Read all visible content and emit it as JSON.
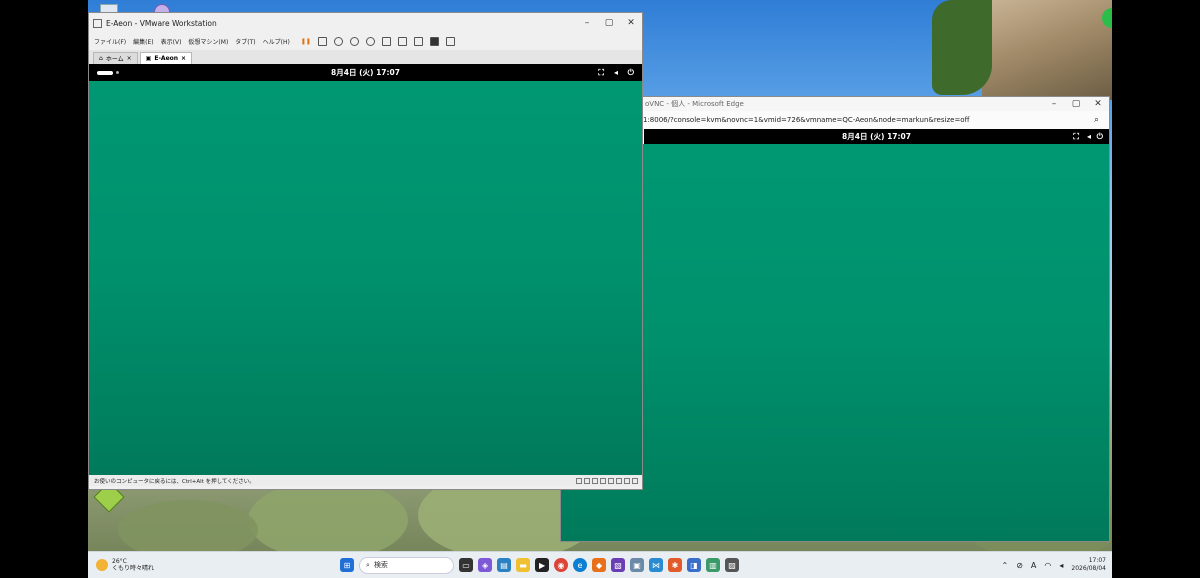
{
  "vmware": {
    "title": "E-Aeon - VMware Workstation",
    "menu": [
      "ファイル(F)",
      "編集(E)",
      "表示(V)",
      "仮想マシン(M)",
      "タブ(T)",
      "ヘルプ(H)"
    ],
    "tabs": [
      {
        "label": "ホーム"
      },
      {
        "label": "E-Aeon"
      }
    ],
    "guest_clock": "8月4日 (火)  17:07",
    "status_text": "お使いのコンピュータに戻るには、Ctrl+Alt を押してください。"
  },
  "edge": {
    "title": "oVNC - 個人 - Microsoft Edge",
    "url": "1:8006/?console=kvm&novnc=1&vmid=726&vmname=QC-Aeon&node=markun&resize=off",
    "guest_clock": "8月4日 (火)  17:07"
  },
  "taskbar": {
    "weather_temp": "26°C",
    "weather_desc": "くもり時々晴れ",
    "search_placeholder": "検索",
    "time": "17:07",
    "date": "2026/08/04",
    "ime": "A"
  },
  "colors": {
    "guest_green": "#009873",
    "taskbar_bg": "#e9eef3"
  }
}
